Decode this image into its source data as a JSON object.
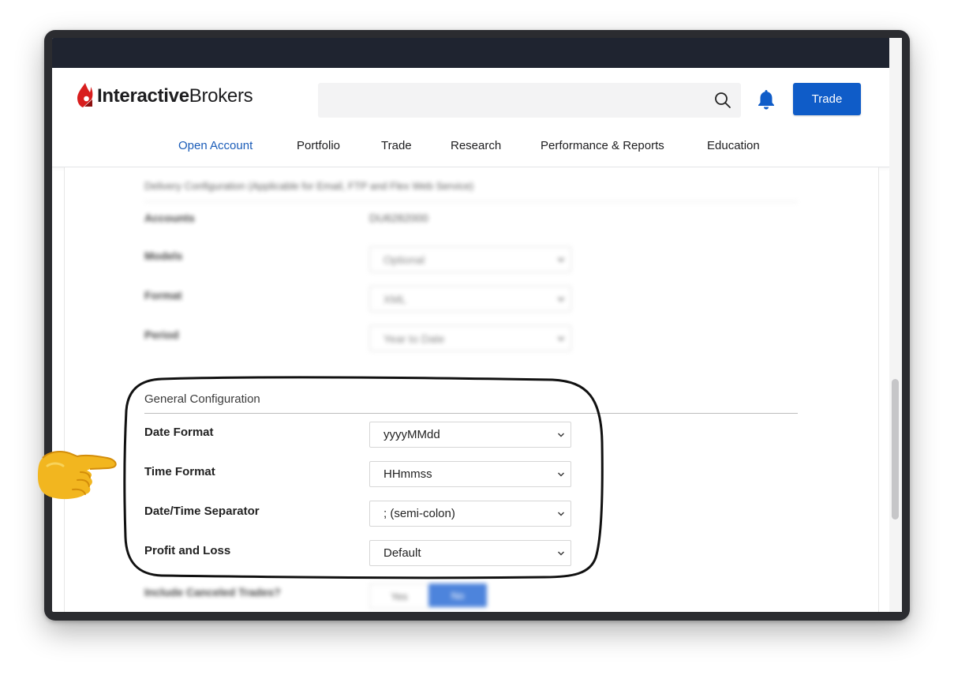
{
  "brand": {
    "logo_part1": "Interactive",
    "logo_part2": "Brokers"
  },
  "colors": {
    "accent": "#0f5cc8",
    "topbar": "#1f2430",
    "logo_red": "#d81e1e",
    "active_nav": "#1a5cb8"
  },
  "header": {
    "search_placeholder": "",
    "search_icon": "search-icon",
    "bell_icon": "bell-icon",
    "trade_button": "Trade"
  },
  "nav": {
    "items": [
      {
        "label": "Open Account",
        "active": true
      },
      {
        "label": "Portfolio"
      },
      {
        "label": "Trade"
      },
      {
        "label": "Research"
      },
      {
        "label": "Performance & Reports"
      },
      {
        "label": "Education"
      }
    ]
  },
  "delivery": {
    "title": "Delivery Configuration (Applicable for Email, FTP and Flex Web Service)",
    "rows": [
      {
        "label": "Accounts",
        "value": "DU6282000"
      },
      {
        "label": "Models",
        "value": "Optional"
      },
      {
        "label": "Format",
        "value": "XML"
      },
      {
        "label": "Period",
        "value": "Year to Date"
      }
    ]
  },
  "general": {
    "title": "General Configuration",
    "rows": [
      {
        "label": "Date Format",
        "value": "yyyyMMdd"
      },
      {
        "label": "Time Format",
        "value": "HHmmss"
      },
      {
        "label": "Date/Time Separator",
        "value": "; (semi-colon)"
      },
      {
        "label": "Profit and Loss",
        "value": "Default"
      }
    ]
  },
  "canceled": {
    "label": "Include Canceled Trades?",
    "yes": "Yes",
    "no": "No"
  }
}
